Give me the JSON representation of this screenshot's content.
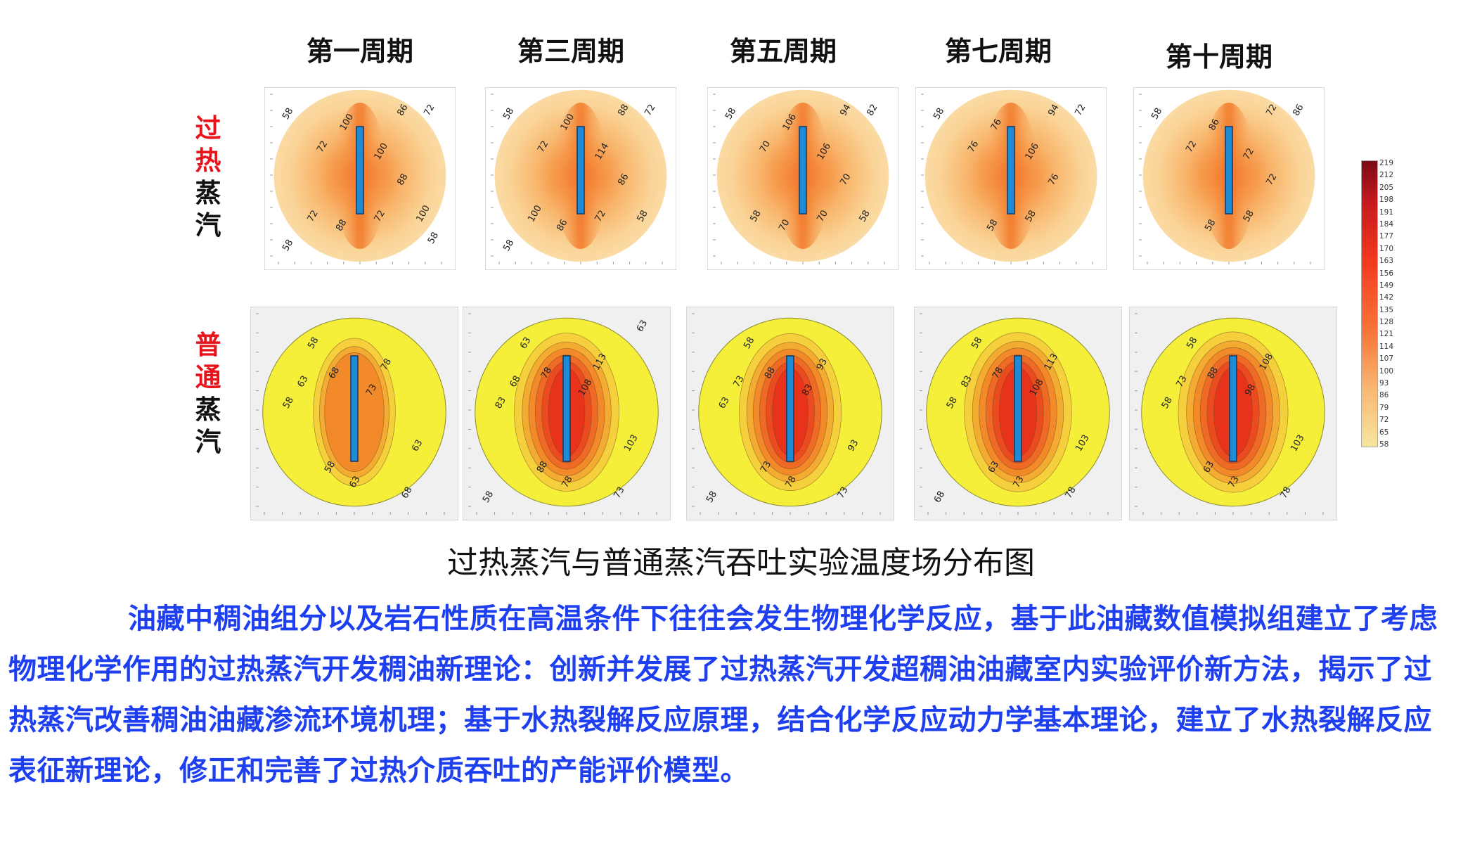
{
  "columns": [
    "第一周期",
    "第三周期",
    "第五周期",
    "第七周期",
    "第十周期"
  ],
  "rows": [
    {
      "red_chars": [
        "过",
        "热"
      ],
      "black_chars": [
        "蒸",
        "汽"
      ]
    },
    {
      "red_chars": [
        "普",
        "通"
      ],
      "black_chars": [
        "蒸",
        "汽"
      ]
    }
  ],
  "colorbar": {
    "ticks": [
      "219",
      "212",
      "205",
      "198",
      "191",
      "184",
      "177",
      "170",
      "163",
      "156",
      "149",
      "142",
      "135",
      "128",
      "121",
      "114",
      "107",
      "100",
      "93",
      "86",
      "79",
      "72",
      "65",
      "58"
    ],
    "colors": {
      "high": "#7a0a14",
      "mid": "#f23a1e",
      "low": "#f7e6a0"
    }
  },
  "contour_labels": {
    "superheated": [
      [
        "58",
        "100",
        "86",
        "72",
        "72",
        "88",
        "100",
        "72",
        "88",
        "72",
        "100",
        "58",
        "58"
      ],
      [
        "58",
        "100",
        "88",
        "72",
        "72",
        "86",
        "114",
        "72",
        "86",
        "100",
        "58",
        "58"
      ],
      [
        "58",
        "106",
        "94",
        "70",
        "82",
        "70",
        "106",
        "70",
        "70",
        "58",
        "58"
      ],
      [
        "58",
        "76",
        "94",
        "76",
        "72",
        "76",
        "106",
        "58",
        "58"
      ],
      [
        "58",
        "86",
        "72",
        "72",
        "86",
        "72",
        "72",
        "58",
        "58"
      ]
    ],
    "normal": [
      [
        "58",
        "63",
        "68",
        "73",
        "78",
        "63",
        "68",
        "63",
        "58",
        "58"
      ],
      [
        "63",
        "68",
        "78",
        "108",
        "113",
        "103",
        "73",
        "78",
        "88",
        "83",
        "58",
        "63"
      ],
      [
        "58",
        "73",
        "88",
        "83",
        "93",
        "93",
        "73",
        "78",
        "73",
        "63",
        "58"
      ],
      [
        "58",
        "83",
        "78",
        "108",
        "113",
        "103",
        "78",
        "73",
        "63",
        "58",
        "68"
      ],
      [
        "58",
        "73",
        "88",
        "98",
        "108",
        "103",
        "78",
        "73",
        "63",
        "58"
      ]
    ]
  },
  "caption": "过热蒸汽与普通蒸汽吞吐实验温度场分布图",
  "paragraph": "油藏中稠油组分以及岩石性质在高温条件下往往会发生物理化学反应，基于此油藏数值模拟组建立了考虑物理化学作用的过热蒸汽开发稠油新理论：创新并发展了过热蒸汽开发超稠油油藏室内实验评价新方法，揭示了过热蒸汽改善稠油油藏渗流环境机理；基于水热裂解反应原理，结合化学反应动力学基本理论，建立了水热裂解反应表征新理论，修正和完善了过热介质吞吐的产能评价模型。"
}
